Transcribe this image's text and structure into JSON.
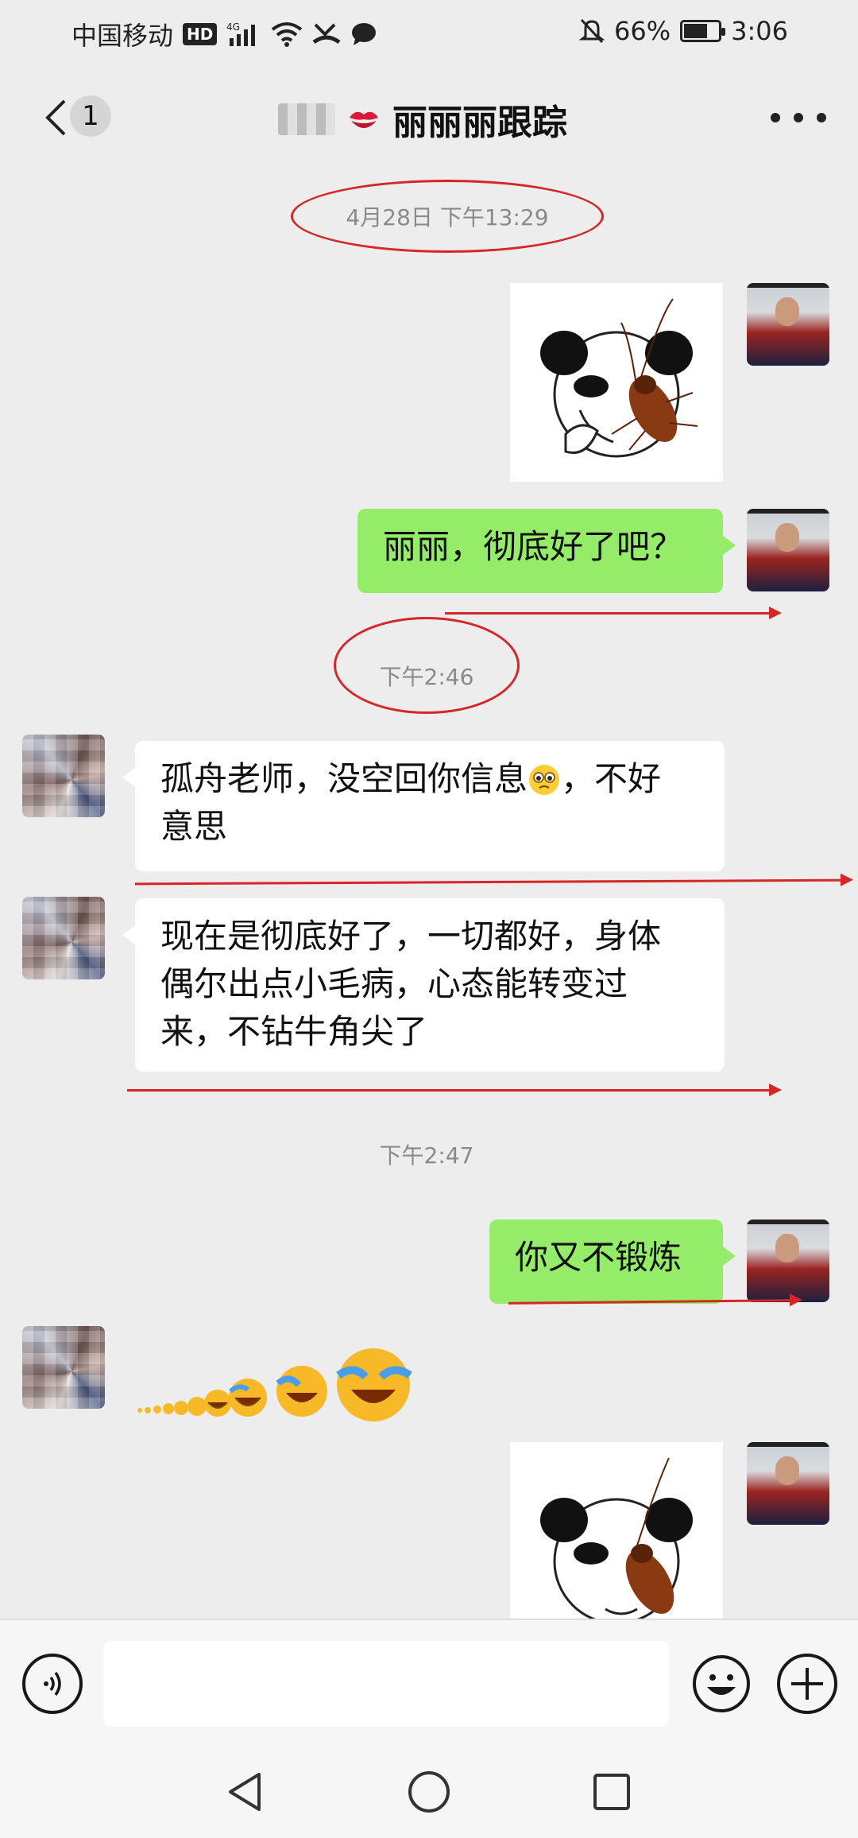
{
  "status_bar": {
    "carrier": "中国移动",
    "hd": "HD",
    "network": "4G",
    "battery": "66%",
    "battery_level": 0.66,
    "time": "3:06"
  },
  "nav": {
    "unread_count": "1",
    "title": "丽丽丽跟踪"
  },
  "messages": {
    "ts1": "4月28日 下午13:29",
    "msg_me_1": "丽丽，彻底好了吧？",
    "ts2": "下午2:46",
    "msg_other_1_a": "孤舟老师，没空回你信息",
    "msg_other_1_b": "，不好",
    "msg_other_1_c": "意思",
    "msg_other_2_a": "现在是彻底好了，一切都好，身体",
    "msg_other_2_b": "偶尔出点小毛病，心态能转变过",
    "msg_other_2_c": "来，不钻牛角尖了",
    "ts3": "下午2:47",
    "msg_me_2": "你又不锻炼"
  },
  "input": {
    "placeholder": ""
  },
  "colors": {
    "bubble_me": "#95ec69",
    "bubble_other": "#ffffff",
    "annotation_red": "#d62626",
    "background": "#ededed"
  },
  "icons": [
    "back-icon",
    "more-icon",
    "voice-icon",
    "emoji-icon",
    "plus-icon",
    "nav-back-icon",
    "nav-home-icon",
    "nav-recents-icon",
    "wifi-icon",
    "signal-icon",
    "mute-icon",
    "message-icon",
    "battery-icon",
    "kiss-icon"
  ]
}
